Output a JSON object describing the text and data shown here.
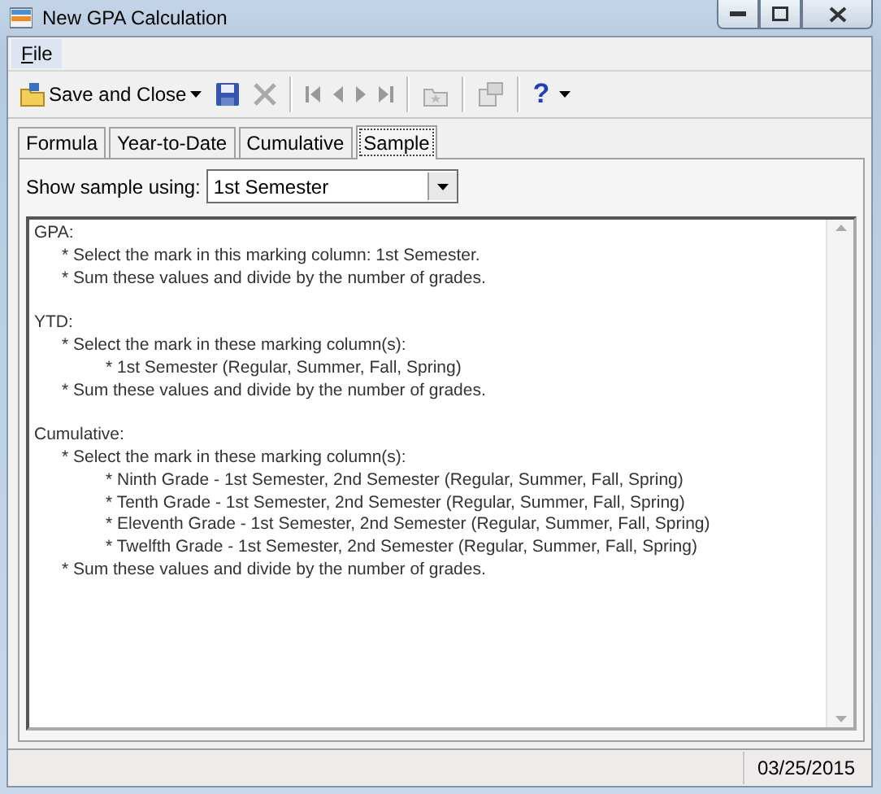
{
  "window": {
    "title": "New GPA Calculation"
  },
  "menu": [
    {
      "label": "File"
    }
  ],
  "toolbar": [
    {
      "kind": "labeled",
      "label": "Save and Close",
      "disabled": false
    },
    {
      "kind": "icon",
      "disabled": false
    },
    {
      "kind": "icon",
      "disabled": true
    },
    {
      "kind": "separator"
    },
    {
      "kind": "icon",
      "disabled": true
    },
    {
      "kind": "icon",
      "disabled": true
    },
    {
      "kind": "icon",
      "disabled": true
    },
    {
      "kind": "icon",
      "disabled": true
    },
    {
      "kind": "separator"
    },
    {
      "kind": "icon",
      "disabled": true
    },
    {
      "kind": "separator"
    },
    {
      "kind": "icon",
      "disabled": true
    },
    {
      "kind": "separator"
    },
    {
      "kind": "help",
      "label": "?",
      "disabled": false
    }
  ],
  "tabs": [
    {
      "label": "Formula",
      "selected": false
    },
    {
      "label": "Year-to-Date",
      "selected": false
    },
    {
      "label": "Cumulative",
      "selected": false
    },
    {
      "label": "Sample",
      "selected": true
    }
  ],
  "sample_selector": {
    "label": "Show sample using:",
    "value": "1st Semester"
  },
  "sample_text": [
    {
      "text": "GPA:",
      "children": [
        {
          "text": "* Select the mark in this marking column: 1st Semester."
        },
        {
          "text": "* Sum these values and divide by the number of grades."
        }
      ]
    },
    {
      "text": "YTD:",
      "children": [
        {
          "text": "* Select the mark in these marking column(s):",
          "children": [
            {
              "text": "* 1st Semester (Regular, Summer, Fall, Spring)"
            }
          ]
        },
        {
          "text": "* Sum these values and divide by the number of grades."
        }
      ]
    },
    {
      "text": "Cumulative:",
      "children": [
        {
          "text": "* Select the mark in these marking column(s):",
          "children": [
            {
              "text": "* Ninth Grade - 1st Semester, 2nd Semester (Regular, Summer, Fall, Spring)"
            },
            {
              "text": "* Tenth Grade - 1st Semester, 2nd Semester (Regular, Summer, Fall, Spring)"
            },
            {
              "text": "* Eleventh Grade - 1st Semester, 2nd Semester (Regular, Summer, Fall, Spring)"
            },
            {
              "text": "* Twelfth Grade - 1st Semester, 2nd Semester (Regular, Summer, Fall, Spring)"
            }
          ]
        },
        {
          "text": "* Sum these values and divide by the number of grades."
        }
      ]
    }
  ],
  "status_bar": {
    "date": "03/25/2015"
  }
}
